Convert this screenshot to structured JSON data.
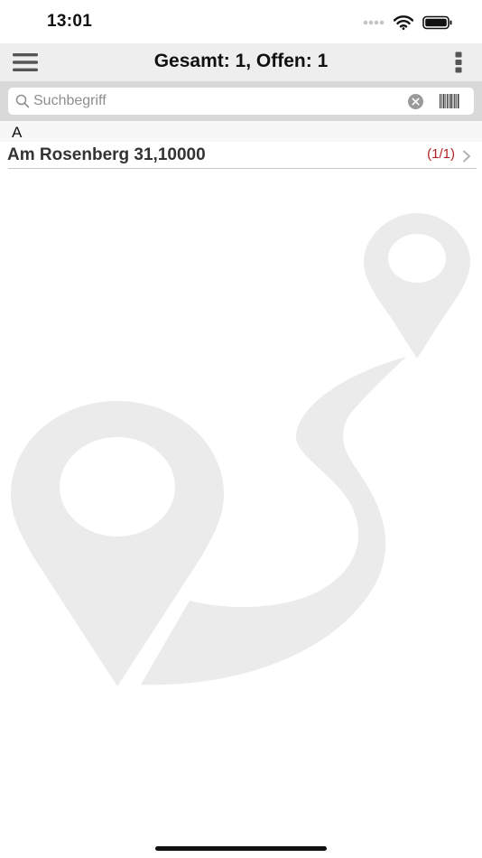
{
  "status_bar": {
    "time": "13:01"
  },
  "nav": {
    "title": "Gesamt: 1, Offen: 1",
    "menu_icon": "hamburger-menu-icon",
    "more_icon": "vertical-dots-icon"
  },
  "search": {
    "placeholder": "Suchbegriff",
    "value": ""
  },
  "list": {
    "section_header": "A",
    "items": [
      {
        "label": "Am Rosenberg 31,10000",
        "count": "(1/1)"
      }
    ]
  },
  "colors": {
    "nav_background": "#eeeeee",
    "search_area_background": "#d9d9d9",
    "count_accent": "#b22222",
    "watermark": "#ebebeb"
  }
}
